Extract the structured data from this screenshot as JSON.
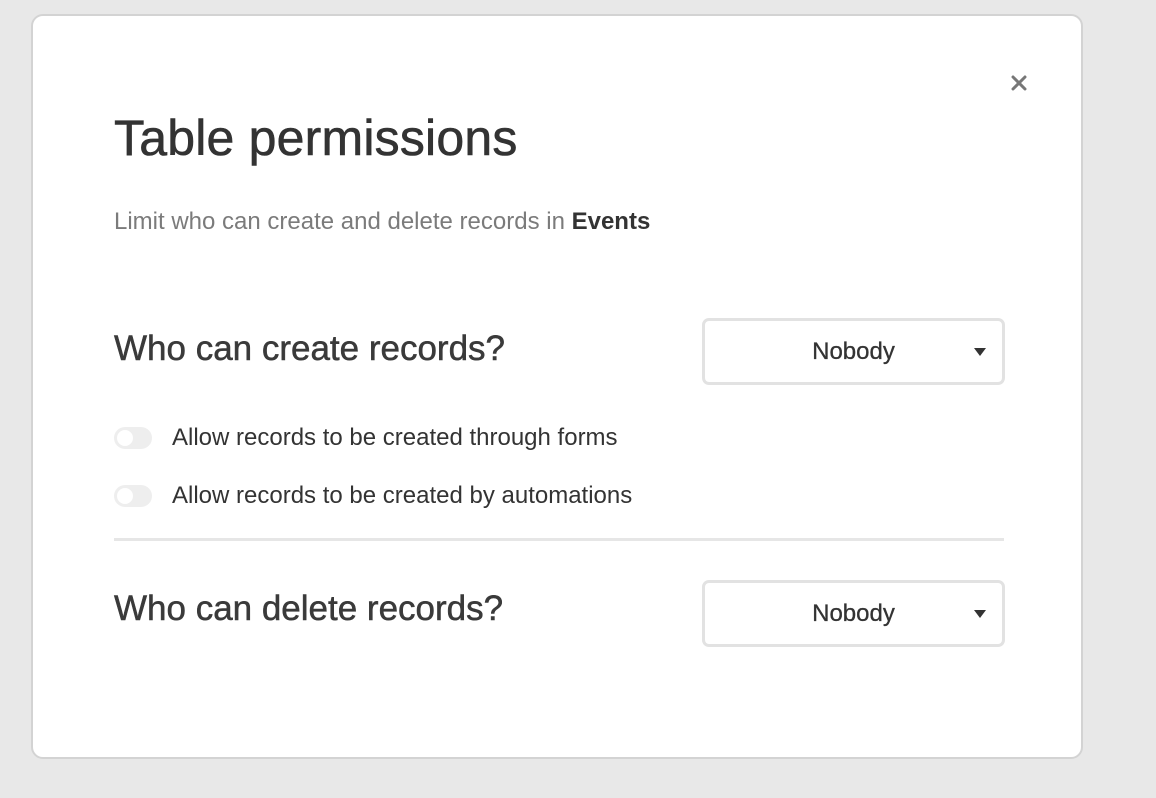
{
  "modal": {
    "close_label": "×",
    "title": "Table permissions",
    "subtitle_prefix": "Limit who can create and delete records in ",
    "table_name": "Events"
  },
  "create": {
    "heading": "Who can create records?",
    "selected": "Nobody",
    "toggles": [
      {
        "label": "Allow records to be created through forms",
        "on": false
      },
      {
        "label": "Allow records to be created by automations",
        "on": false
      }
    ]
  },
  "delete": {
    "heading": "Who can delete records?",
    "selected": "Nobody"
  },
  "colors": {
    "background": "#e8e8e8",
    "text": "#333333",
    "muted": "#7b7b7b",
    "border": "#e2e2e2"
  }
}
